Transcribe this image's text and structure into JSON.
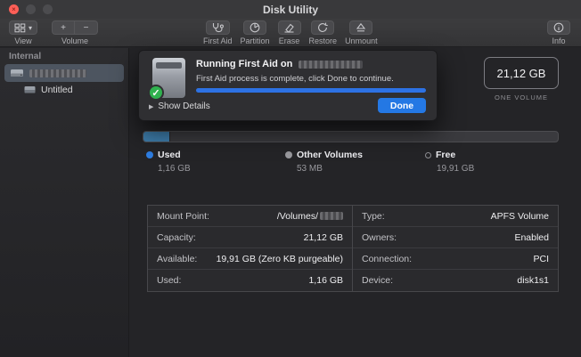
{
  "window": {
    "title": "Disk Utility"
  },
  "titlebar": {
    "close_glyph": "×"
  },
  "toolbar": {
    "view": {
      "label": "View"
    },
    "volume": {
      "label": "Volume",
      "plus": "+",
      "minus": "−"
    },
    "actions": [
      {
        "label": "First Aid"
      },
      {
        "label": "Partition"
      },
      {
        "label": "Erase"
      },
      {
        "label": "Restore"
      },
      {
        "label": "Unmount"
      }
    ],
    "info": {
      "label": "Info"
    }
  },
  "sidebar": {
    "section": "Internal",
    "items": [
      {
        "label": "",
        "redacted": true
      },
      {
        "label": "Untitled",
        "redacted": false
      }
    ]
  },
  "dialog": {
    "title_prefix": "Running First Aid on",
    "message": "First Aid process is complete, click Done to continue.",
    "show_details": "Show Details",
    "done_label": "Done",
    "check_glyph": "✓",
    "disclosure_glyph": "▶",
    "progress_percent": 100
  },
  "volume_summary": {
    "size": "21,12 GB",
    "subtitle": "ONE VOLUME"
  },
  "usage": {
    "segments": [
      {
        "name": "used",
        "color": "#3f7fae",
        "percent": 6.5
      }
    ],
    "legend": [
      {
        "label": "Used",
        "value": "1,16 GB",
        "color": "#2e7de1",
        "style": "filled"
      },
      {
        "label": "Other Volumes",
        "value": "53 MB",
        "color": "#98989d",
        "style": "filled"
      },
      {
        "label": "Free",
        "value": "19,91 GB",
        "color": "transparent",
        "style": "hollow"
      }
    ]
  },
  "details": {
    "left": [
      {
        "key": "Mount Point:",
        "value": "/Volumes/"
      },
      {
        "key": "Capacity:",
        "value": "21,12 GB"
      },
      {
        "key": "Available:",
        "value": "19,91 GB (Zero KB purgeable)"
      },
      {
        "key": "Used:",
        "value": "1,16 GB"
      }
    ],
    "right": [
      {
        "key": "Type:",
        "value": "APFS Volume"
      },
      {
        "key": "Owners:",
        "value": "Enabled"
      },
      {
        "key": "Connection:",
        "value": "PCI"
      },
      {
        "key": "Device:",
        "value": "disk1s1"
      }
    ]
  },
  "colors": {
    "accent": "#2478e4",
    "progress": "#2d72e4",
    "success": "#2fb14e"
  }
}
